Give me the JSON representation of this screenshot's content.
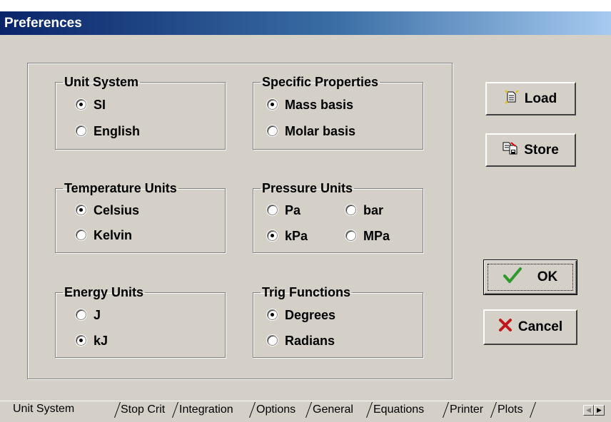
{
  "window": {
    "title": "Preferences"
  },
  "groups": {
    "unit_system": {
      "label": "Unit System",
      "options": [
        "SI",
        "English"
      ],
      "selected": "SI"
    },
    "specific_properties": {
      "label": "Specific Properties",
      "options": [
        "Mass basis",
        "Molar basis"
      ],
      "selected": "Mass basis"
    },
    "temperature_units": {
      "label": "Temperature Units",
      "options": [
        "Celsius",
        "Kelvin"
      ],
      "selected": "Celsius"
    },
    "pressure_units": {
      "label": "Pressure Units",
      "options": [
        "Pa",
        "bar",
        "kPa",
        "MPa"
      ],
      "selected": "kPa"
    },
    "energy_units": {
      "label": "Energy Units",
      "options": [
        "J",
        "kJ"
      ],
      "selected": "kJ"
    },
    "trig_functions": {
      "label": "Trig Functions",
      "options": [
        "Degrees",
        "Radians"
      ],
      "selected": "Degrees"
    }
  },
  "buttons": {
    "load": "Load",
    "store": "Store",
    "ok": "OK",
    "cancel": "Cancel"
  },
  "tabs": [
    "Unit System",
    "Stop Crit",
    "Integration",
    "Options",
    "General",
    "Equations",
    "Printer",
    "Plots"
  ],
  "active_tab": "Unit System",
  "colors": {
    "face": "#d4d0c8",
    "title_start": "#0a246a",
    "title_end": "#a6caf0",
    "ok_check": "#2e9a2e",
    "cancel_x": "#c0181a"
  }
}
